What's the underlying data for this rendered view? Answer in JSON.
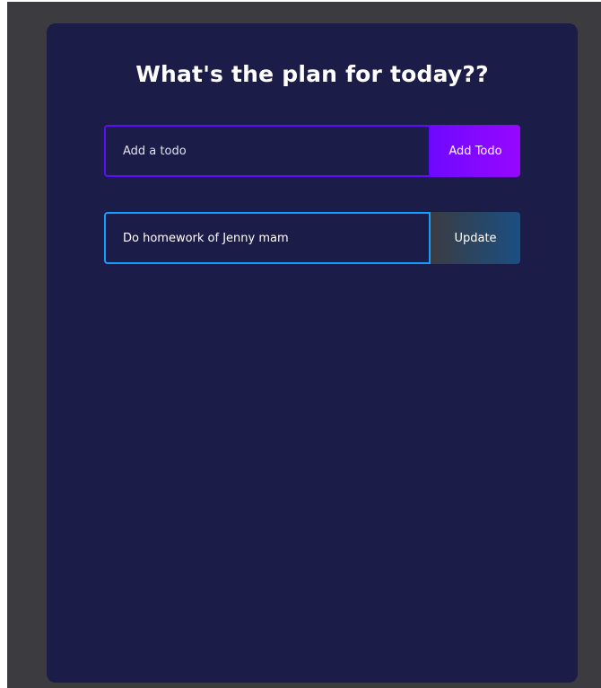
{
  "app": {
    "title": "What's the plan for today??"
  },
  "add_form": {
    "placeholder": "Add a todo",
    "value": "",
    "button_label": "Add Todo"
  },
  "edit_form": {
    "value": "Do homework of Jenny mam",
    "button_label": "Update"
  },
  "colors": {
    "page_background": "#3c3c40",
    "card_background": "#1c1c49",
    "add_border": "#5d0cff",
    "add_button_start": "#7008ff",
    "add_button_end": "#9607ff",
    "edit_border": "#149fff",
    "edit_button_start": "#3b3c42",
    "edit_button_end": "#1b4e82",
    "text": "#ffffff"
  }
}
